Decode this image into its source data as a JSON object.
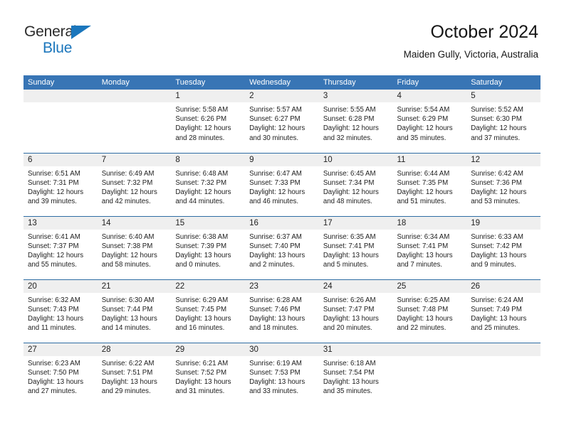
{
  "brand": {
    "name_part1": "General",
    "name_part2": "Blue"
  },
  "header": {
    "title": "October 2024",
    "subtitle": "Maiden Gully, Victoria, Australia"
  },
  "colors": {
    "header_blue": "#3875b5",
    "row_divider_blue": "#2e6da4",
    "daynum_band": "#efefef",
    "brand_blue": "#1b76bc",
    "text": "#1d1d1d"
  },
  "weekday_headers": [
    "Sunday",
    "Monday",
    "Tuesday",
    "Wednesday",
    "Thursday",
    "Friday",
    "Saturday"
  ],
  "weeks": [
    [
      {
        "day": "",
        "lines": [
          "",
          "",
          "",
          ""
        ],
        "empty": true
      },
      {
        "day": "",
        "lines": [
          "",
          "",
          "",
          ""
        ],
        "empty": true
      },
      {
        "day": "1",
        "lines": [
          "Sunrise: 5:58 AM",
          "Sunset: 6:26 PM",
          "Daylight: 12 hours",
          "and 28 minutes."
        ]
      },
      {
        "day": "2",
        "lines": [
          "Sunrise: 5:57 AM",
          "Sunset: 6:27 PM",
          "Daylight: 12 hours",
          "and 30 minutes."
        ]
      },
      {
        "day": "3",
        "lines": [
          "Sunrise: 5:55 AM",
          "Sunset: 6:28 PM",
          "Daylight: 12 hours",
          "and 32 minutes."
        ]
      },
      {
        "day": "4",
        "lines": [
          "Sunrise: 5:54 AM",
          "Sunset: 6:29 PM",
          "Daylight: 12 hours",
          "and 35 minutes."
        ]
      },
      {
        "day": "5",
        "lines": [
          "Sunrise: 5:52 AM",
          "Sunset: 6:30 PM",
          "Daylight: 12 hours",
          "and 37 minutes."
        ]
      }
    ],
    [
      {
        "day": "6",
        "lines": [
          "Sunrise: 6:51 AM",
          "Sunset: 7:31 PM",
          "Daylight: 12 hours",
          "and 39 minutes."
        ]
      },
      {
        "day": "7",
        "lines": [
          "Sunrise: 6:49 AM",
          "Sunset: 7:32 PM",
          "Daylight: 12 hours",
          "and 42 minutes."
        ]
      },
      {
        "day": "8",
        "lines": [
          "Sunrise: 6:48 AM",
          "Sunset: 7:32 PM",
          "Daylight: 12 hours",
          "and 44 minutes."
        ]
      },
      {
        "day": "9",
        "lines": [
          "Sunrise: 6:47 AM",
          "Sunset: 7:33 PM",
          "Daylight: 12 hours",
          "and 46 minutes."
        ]
      },
      {
        "day": "10",
        "lines": [
          "Sunrise: 6:45 AM",
          "Sunset: 7:34 PM",
          "Daylight: 12 hours",
          "and 48 minutes."
        ]
      },
      {
        "day": "11",
        "lines": [
          "Sunrise: 6:44 AM",
          "Sunset: 7:35 PM",
          "Daylight: 12 hours",
          "and 51 minutes."
        ]
      },
      {
        "day": "12",
        "lines": [
          "Sunrise: 6:42 AM",
          "Sunset: 7:36 PM",
          "Daylight: 12 hours",
          "and 53 minutes."
        ]
      }
    ],
    [
      {
        "day": "13",
        "lines": [
          "Sunrise: 6:41 AM",
          "Sunset: 7:37 PM",
          "Daylight: 12 hours",
          "and 55 minutes."
        ]
      },
      {
        "day": "14",
        "lines": [
          "Sunrise: 6:40 AM",
          "Sunset: 7:38 PM",
          "Daylight: 12 hours",
          "and 58 minutes."
        ]
      },
      {
        "day": "15",
        "lines": [
          "Sunrise: 6:38 AM",
          "Sunset: 7:39 PM",
          "Daylight: 13 hours",
          "and 0 minutes."
        ]
      },
      {
        "day": "16",
        "lines": [
          "Sunrise: 6:37 AM",
          "Sunset: 7:40 PM",
          "Daylight: 13 hours",
          "and 2 minutes."
        ]
      },
      {
        "day": "17",
        "lines": [
          "Sunrise: 6:35 AM",
          "Sunset: 7:41 PM",
          "Daylight: 13 hours",
          "and 5 minutes."
        ]
      },
      {
        "day": "18",
        "lines": [
          "Sunrise: 6:34 AM",
          "Sunset: 7:41 PM",
          "Daylight: 13 hours",
          "and 7 minutes."
        ]
      },
      {
        "day": "19",
        "lines": [
          "Sunrise: 6:33 AM",
          "Sunset: 7:42 PM",
          "Daylight: 13 hours",
          "and 9 minutes."
        ]
      }
    ],
    [
      {
        "day": "20",
        "lines": [
          "Sunrise: 6:32 AM",
          "Sunset: 7:43 PM",
          "Daylight: 13 hours",
          "and 11 minutes."
        ]
      },
      {
        "day": "21",
        "lines": [
          "Sunrise: 6:30 AM",
          "Sunset: 7:44 PM",
          "Daylight: 13 hours",
          "and 14 minutes."
        ]
      },
      {
        "day": "22",
        "lines": [
          "Sunrise: 6:29 AM",
          "Sunset: 7:45 PM",
          "Daylight: 13 hours",
          "and 16 minutes."
        ]
      },
      {
        "day": "23",
        "lines": [
          "Sunrise: 6:28 AM",
          "Sunset: 7:46 PM",
          "Daylight: 13 hours",
          "and 18 minutes."
        ]
      },
      {
        "day": "24",
        "lines": [
          "Sunrise: 6:26 AM",
          "Sunset: 7:47 PM",
          "Daylight: 13 hours",
          "and 20 minutes."
        ]
      },
      {
        "day": "25",
        "lines": [
          "Sunrise: 6:25 AM",
          "Sunset: 7:48 PM",
          "Daylight: 13 hours",
          "and 22 minutes."
        ]
      },
      {
        "day": "26",
        "lines": [
          "Sunrise: 6:24 AM",
          "Sunset: 7:49 PM",
          "Daylight: 13 hours",
          "and 25 minutes."
        ]
      }
    ],
    [
      {
        "day": "27",
        "lines": [
          "Sunrise: 6:23 AM",
          "Sunset: 7:50 PM",
          "Daylight: 13 hours",
          "and 27 minutes."
        ]
      },
      {
        "day": "28",
        "lines": [
          "Sunrise: 6:22 AM",
          "Sunset: 7:51 PM",
          "Daylight: 13 hours",
          "and 29 minutes."
        ]
      },
      {
        "day": "29",
        "lines": [
          "Sunrise: 6:21 AM",
          "Sunset: 7:52 PM",
          "Daylight: 13 hours",
          "and 31 minutes."
        ]
      },
      {
        "day": "30",
        "lines": [
          "Sunrise: 6:19 AM",
          "Sunset: 7:53 PM",
          "Daylight: 13 hours",
          "and 33 minutes."
        ]
      },
      {
        "day": "31",
        "lines": [
          "Sunrise: 6:18 AM",
          "Sunset: 7:54 PM",
          "Daylight: 13 hours",
          "and 35 minutes."
        ]
      },
      {
        "day": "",
        "lines": [
          "",
          "",
          "",
          ""
        ],
        "empty": true
      },
      {
        "day": "",
        "lines": [
          "",
          "",
          "",
          ""
        ],
        "empty": true
      }
    ]
  ]
}
